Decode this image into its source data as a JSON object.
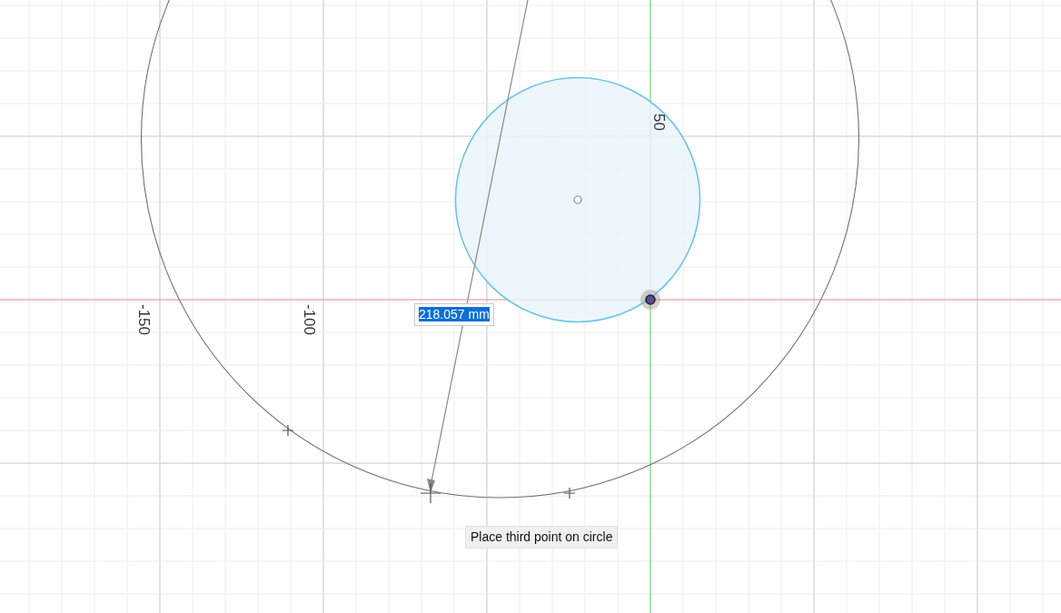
{
  "axis_labels": [
    {
      "text": "-150"
    },
    {
      "text": "-100"
    },
    {
      "text": "50"
    }
  ],
  "dimension_input": {
    "value": "218.057 mm",
    "selected": true
  },
  "tooltip": {
    "text": "Place third point on circle"
  }
}
